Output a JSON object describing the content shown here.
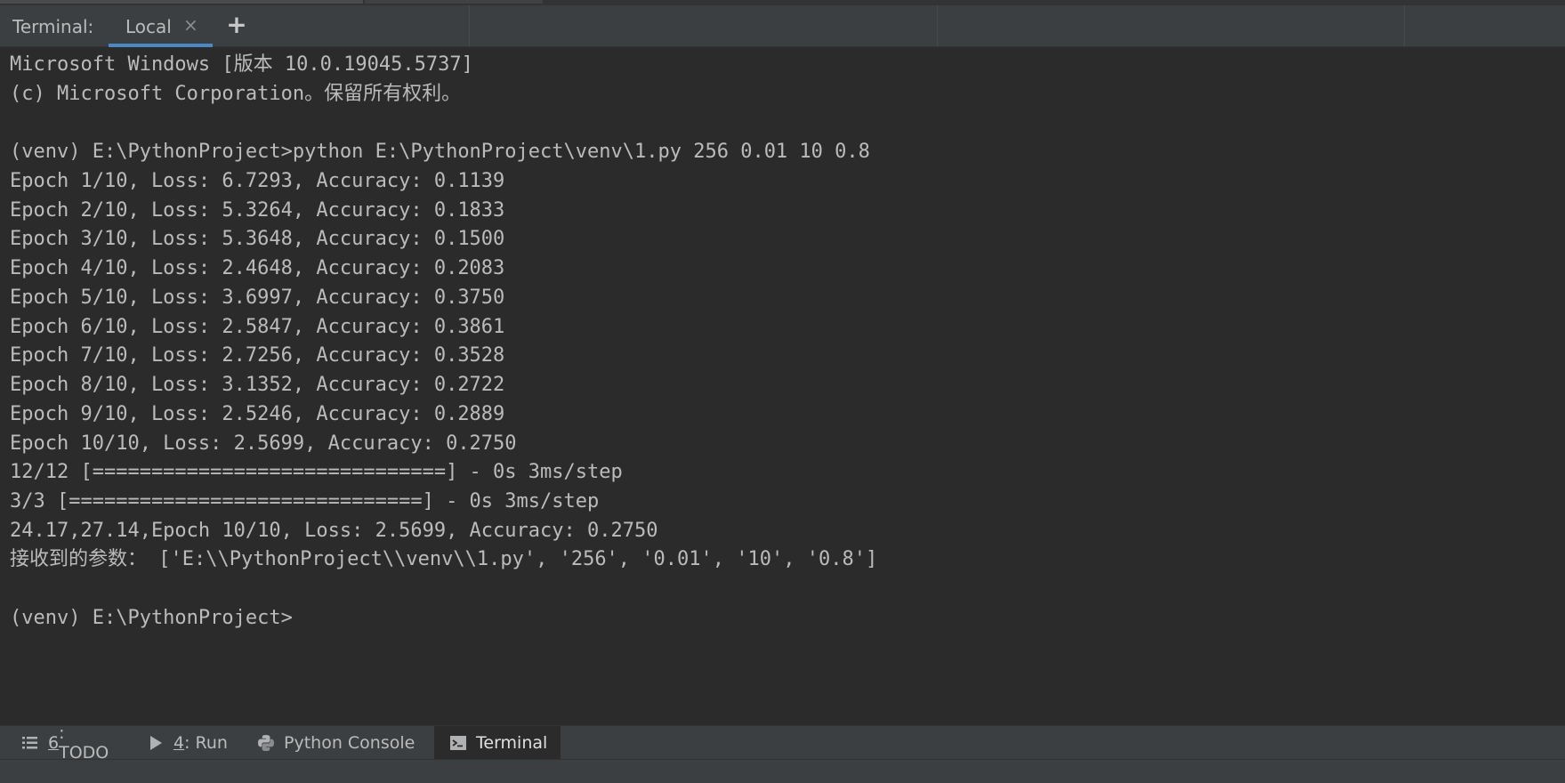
{
  "header": {
    "title": "Terminal:",
    "tabs": [
      {
        "label": "Local"
      }
    ],
    "add_tab_glyph": "+",
    "close_glyph": "×"
  },
  "terminal": {
    "lines": [
      "Microsoft Windows [版本 10.0.19045.5737]",
      "(c) Microsoft Corporation。保留所有权利。",
      "",
      "(venv) E:\\PythonProject>python E:\\PythonProject\\venv\\1.py 256 0.01 10 0.8",
      "Epoch 1/10, Loss: 6.7293, Accuracy: 0.1139",
      "Epoch 2/10, Loss: 5.3264, Accuracy: 0.1833",
      "Epoch 3/10, Loss: 5.3648, Accuracy: 0.1500",
      "Epoch 4/10, Loss: 2.4648, Accuracy: 0.2083",
      "Epoch 5/10, Loss: 3.6997, Accuracy: 0.3750",
      "Epoch 6/10, Loss: 2.5847, Accuracy: 0.3861",
      "Epoch 7/10, Loss: 2.7256, Accuracy: 0.3528",
      "Epoch 8/10, Loss: 3.1352, Accuracy: 0.2722",
      "Epoch 9/10, Loss: 2.5246, Accuracy: 0.2889",
      "Epoch 10/10, Loss: 2.5699, Accuracy: 0.2750",
      "12/12 [==============================] - 0s 3ms/step",
      "3/3 [==============================] - 0s 3ms/step",
      "24.17,27.14,Epoch 10/10, Loss: 2.5699, Accuracy: 0.2750",
      "接收到的参数： ['E:\\\\PythonProject\\\\venv\\\\1.py', '256', '0.01', '10', '0.8']",
      "",
      "(venv) E:\\PythonProject>"
    ]
  },
  "bottom_bar": {
    "tools": [
      {
        "num": "6",
        "label": ": TODO",
        "icon": "list-icon"
      },
      {
        "num": "4",
        "label": ": Run",
        "icon": "play-icon"
      },
      {
        "num": "",
        "label": "Python Console",
        "icon": "python-icon"
      },
      {
        "num": "",
        "label": "Terminal",
        "icon": "terminal-icon",
        "active": true
      }
    ]
  },
  "colors": {
    "background": "#2b2b2b",
    "panel": "#3c3f41",
    "text": "#bbbbbb",
    "accent": "#4a88c7"
  }
}
